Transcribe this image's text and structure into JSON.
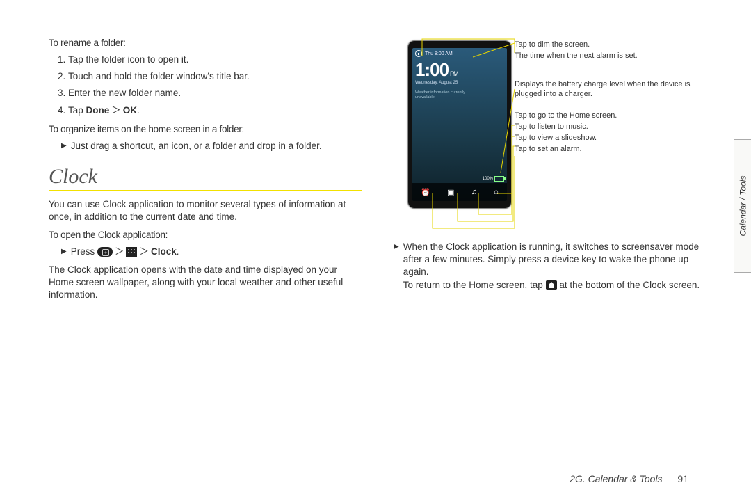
{
  "left": {
    "rename_head": "To rename a folder:",
    "rename_steps": [
      "Tap the folder icon to open it.",
      "Touch and hold the folder window's title bar.",
      "Enter the new folder name."
    ],
    "rename_step4_pre": "Tap ",
    "rename_step4_done": "Done",
    "rename_step4_ok": "OK",
    "organize_head": "To organize items on the home screen in a folder:",
    "organize_item": "Just drag a shortcut, an icon, or a folder and drop in a folder.",
    "clock_title": "Clock",
    "clock_intro": "You can use Clock application to monitor several types of information at once, in addition to the current date and time.",
    "open_head": "To open the Clock application:",
    "open_line_pre": "Press ",
    "open_line_clock": "Clock",
    "open_body": "The Clock application opens with the date and time displayed on your Home screen wallpaper, along with your local weather and other useful information."
  },
  "right": {
    "phone": {
      "status_day": "Thu  8:00 AM",
      "time": "1:00",
      "pm": "PM",
      "date": "Wednesday, August 25",
      "weather1": "Weather information currently",
      "weather2": "unavailable.",
      "battery_pct": "100%"
    },
    "callouts": {
      "c1": "Tap to dim the screen.",
      "c2": "The time when the next alarm is set.",
      "c3": "Displays the battery charge level when the device is plugged into a charger.",
      "c4": "Tap to go to the Home screen.",
      "c5": "Tap to listen to music.",
      "c6": "Tap to view a slideshow.",
      "c7": "Tap to set an alarm."
    },
    "when_running_1": "When the Clock application is running, it switches to screensaver mode after a few minutes. Simply press a device key to wake the phone up again.",
    "when_running_2a": "To return to the Home screen, tap ",
    "when_running_2b": " at the bottom of the Clock screen."
  },
  "footer": {
    "chapter": "2G. Calendar & Tools",
    "page": "91"
  },
  "sidetab": "Calendar / Tools"
}
